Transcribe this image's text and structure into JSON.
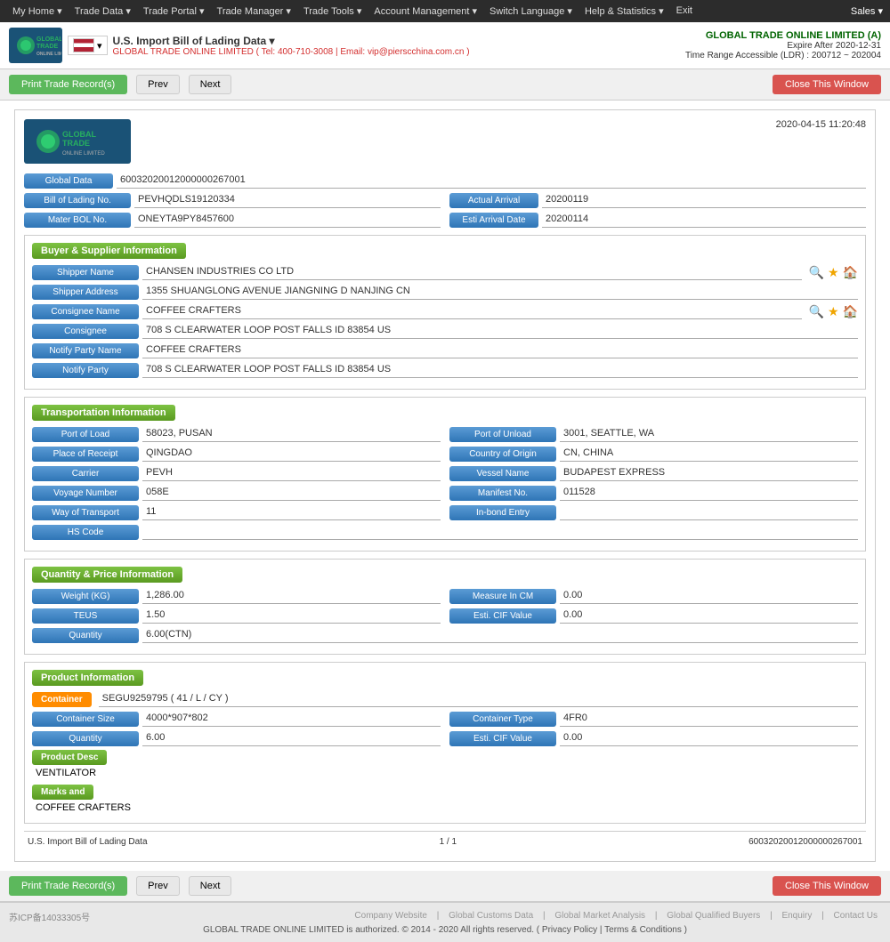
{
  "nav": {
    "items": [
      {
        "label": "My Home ▾"
      },
      {
        "label": "Trade Data ▾"
      },
      {
        "label": "Trade Portal ▾"
      },
      {
        "label": "Trade Manager ▾"
      },
      {
        "label": "Trade Tools ▾"
      },
      {
        "label": "Account Management ▾"
      },
      {
        "label": "Switch Language ▾"
      },
      {
        "label": "Help & Statistics ▾"
      },
      {
        "label": "Exit"
      }
    ],
    "sales": "Sales ▾"
  },
  "header": {
    "data_source": "U.S. Import Bill of Lading Data ▾",
    "company_line": "GLOBAL TRADE ONLINE LIMITED ( Tel: 400-710-3008 | Email: vip@pierscchina.com.cn )",
    "brand": "GLOBAL TRADE ONLINE LIMITED (A)",
    "expire": "Expire After 2020-12-31",
    "time_range": "Time Range Accessible (LDR) : 200712 ~ 202004"
  },
  "action_bar": {
    "print_label": "Print Trade Record(s)",
    "prev_label": "Prev",
    "next_label": "Next",
    "close_label": "Close This Window"
  },
  "doc": {
    "timestamp": "2020-04-15  11:20:48",
    "global_data": {
      "label": "Global Data",
      "value": "60032020012000000267001"
    },
    "bol": {
      "label": "Bill of Lading No.",
      "value": "PEVHQDLS19120334",
      "actual_arrival_label": "Actual Arrival",
      "actual_arrival_value": "20200119"
    },
    "master_bol": {
      "label": "Mater BOL No.",
      "value": "ONEYTA9PY8457600",
      "esti_arrival_label": "Esti Arrival Date",
      "esti_arrival_value": "20200114"
    },
    "buyer_supplier": {
      "section_label": "Buyer & Supplier Information",
      "shipper_name_label": "Shipper Name",
      "shipper_name_value": "CHANSEN INDUSTRIES CO LTD",
      "shipper_address_label": "Shipper Address",
      "shipper_address_value": "1355 SHUANGLONG AVENUE JIANGNING D NANJING CN",
      "consignee_name_label": "Consignee Name",
      "consignee_name_value": "COFFEE CRAFTERS",
      "consignee_label": "Consignee",
      "consignee_value": "708 S CLEARWATER LOOP POST FALLS ID 83854 US",
      "notify_party_name_label": "Notify Party Name",
      "notify_party_name_value": "COFFEE CRAFTERS",
      "notify_party_label": "Notify Party",
      "notify_party_value": "708 S CLEARWATER LOOP POST FALLS ID 83854 US"
    },
    "transport": {
      "section_label": "Transportation Information",
      "port_of_load_label": "Port of Load",
      "port_of_load_value": "58023, PUSAN",
      "port_of_unload_label": "Port of Unload",
      "port_of_unload_value": "3001, SEATTLE, WA",
      "place_of_receipt_label": "Place of Receipt",
      "place_of_receipt_value": "QINGDAO",
      "country_of_origin_label": "Country of Origin",
      "country_of_origin_value": "CN, CHINA",
      "carrier_label": "Carrier",
      "carrier_value": "PEVH",
      "vessel_name_label": "Vessel Name",
      "vessel_name_value": "BUDAPEST EXPRESS",
      "voyage_number_label": "Voyage Number",
      "voyage_number_value": "058E",
      "manifest_no_label": "Manifest No.",
      "manifest_no_value": "011528",
      "way_of_transport_label": "Way of Transport",
      "way_of_transport_value": "11",
      "in_bond_entry_label": "In-bond Entry",
      "in_bond_entry_value": "",
      "hs_code_label": "HS Code",
      "hs_code_value": ""
    },
    "quantity_price": {
      "section_label": "Quantity & Price Information",
      "weight_label": "Weight (KG)",
      "weight_value": "1,286.00",
      "measure_in_cm_label": "Measure In CM",
      "measure_in_cm_value": "0.00",
      "teus_label": "TEUS",
      "teus_value": "1.50",
      "esti_cif_label": "Esti. CIF Value",
      "esti_cif_value": "0.00",
      "quantity_label": "Quantity",
      "quantity_value": "6.00(CTN)"
    },
    "product": {
      "section_label": "Product Information",
      "container_label": "Container",
      "container_value": "SEGU9259795 ( 41 / L / CY )",
      "container_size_label": "Container Size",
      "container_size_value": "4000*907*802",
      "container_type_label": "Container Type",
      "container_type_value": "4FR0",
      "quantity_label": "Quantity",
      "quantity_value": "6.00",
      "esti_cif_label": "Esti. CIF Value",
      "esti_cif_value": "0.00",
      "product_desc_label": "Product Desc",
      "product_desc_value": "VENTILATOR",
      "marks_label": "Marks and",
      "marks_value": "COFFEE CRAFTERS"
    },
    "footer": {
      "left": "U.S. Import Bill of Lading Data",
      "page": "1 / 1",
      "record_id": "60032020012000000267001"
    }
  },
  "page_footer": {
    "icp": "苏ICP备14033305号",
    "links": [
      "Company Website",
      "Global Customs Data",
      "Global Market Analysis",
      "Global Qualified Buyers",
      "Enquiry",
      "Contact Us"
    ],
    "copyright": "GLOBAL TRADE ONLINE LIMITED is authorized. © 2014 - 2020 All rights reserved.  (  Privacy Policy  |  Terms & Conditions  )"
  }
}
